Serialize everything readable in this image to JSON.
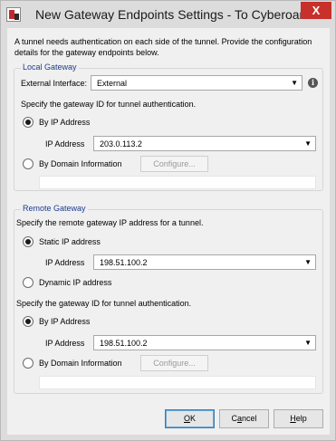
{
  "window": {
    "title": "New Gateway Endpoints Settings - To Cyberoam",
    "close_glyph": "X",
    "icon": "app-logo-icon"
  },
  "intro_text": "A tunnel needs authentication on each side of the tunnel. Provide the configuration details for the gateway endpoints below.",
  "local_gateway": {
    "label": "Local Gateway",
    "external_interface_label": "External Interface:",
    "external_interface_value": "External",
    "info_glyph": "i",
    "specify_id_text": "Specify the gateway ID for tunnel authentication.",
    "by_ip_label": "By IP Address",
    "by_ip_checked": true,
    "ip_label": "IP Address",
    "ip_value": "203.0.113.2",
    "by_domain_label": "By Domain Information",
    "by_domain_checked": false,
    "configure_label": "Configure..."
  },
  "remote_gateway": {
    "label": "Remote Gateway",
    "specify_remote_text": "Specify the remote gateway IP address for a tunnel.",
    "static_ip_label": "Static IP address",
    "static_checked": true,
    "ip_label": "IP Address",
    "ip_value": "198.51.100.2",
    "dynamic_ip_label": "Dynamic IP address",
    "dynamic_checked": false,
    "specify_id_text": "Specify the gateway ID for tunnel authentication.",
    "by_ip_label": "By IP Address",
    "by_ip_checked": true,
    "id_ip_label": "IP Address",
    "id_ip_value": "198.51.100.2",
    "by_domain_label": "By Domain Information",
    "by_domain_checked": false,
    "configure_label": "Configure..."
  },
  "buttons": {
    "ok_mnemonic": "O",
    "ok_rest": "K",
    "cancel_pre": "C",
    "cancel_mnemonic": "a",
    "cancel_rest": "ncel",
    "help_mnemonic": "H",
    "help_rest": "elp"
  }
}
